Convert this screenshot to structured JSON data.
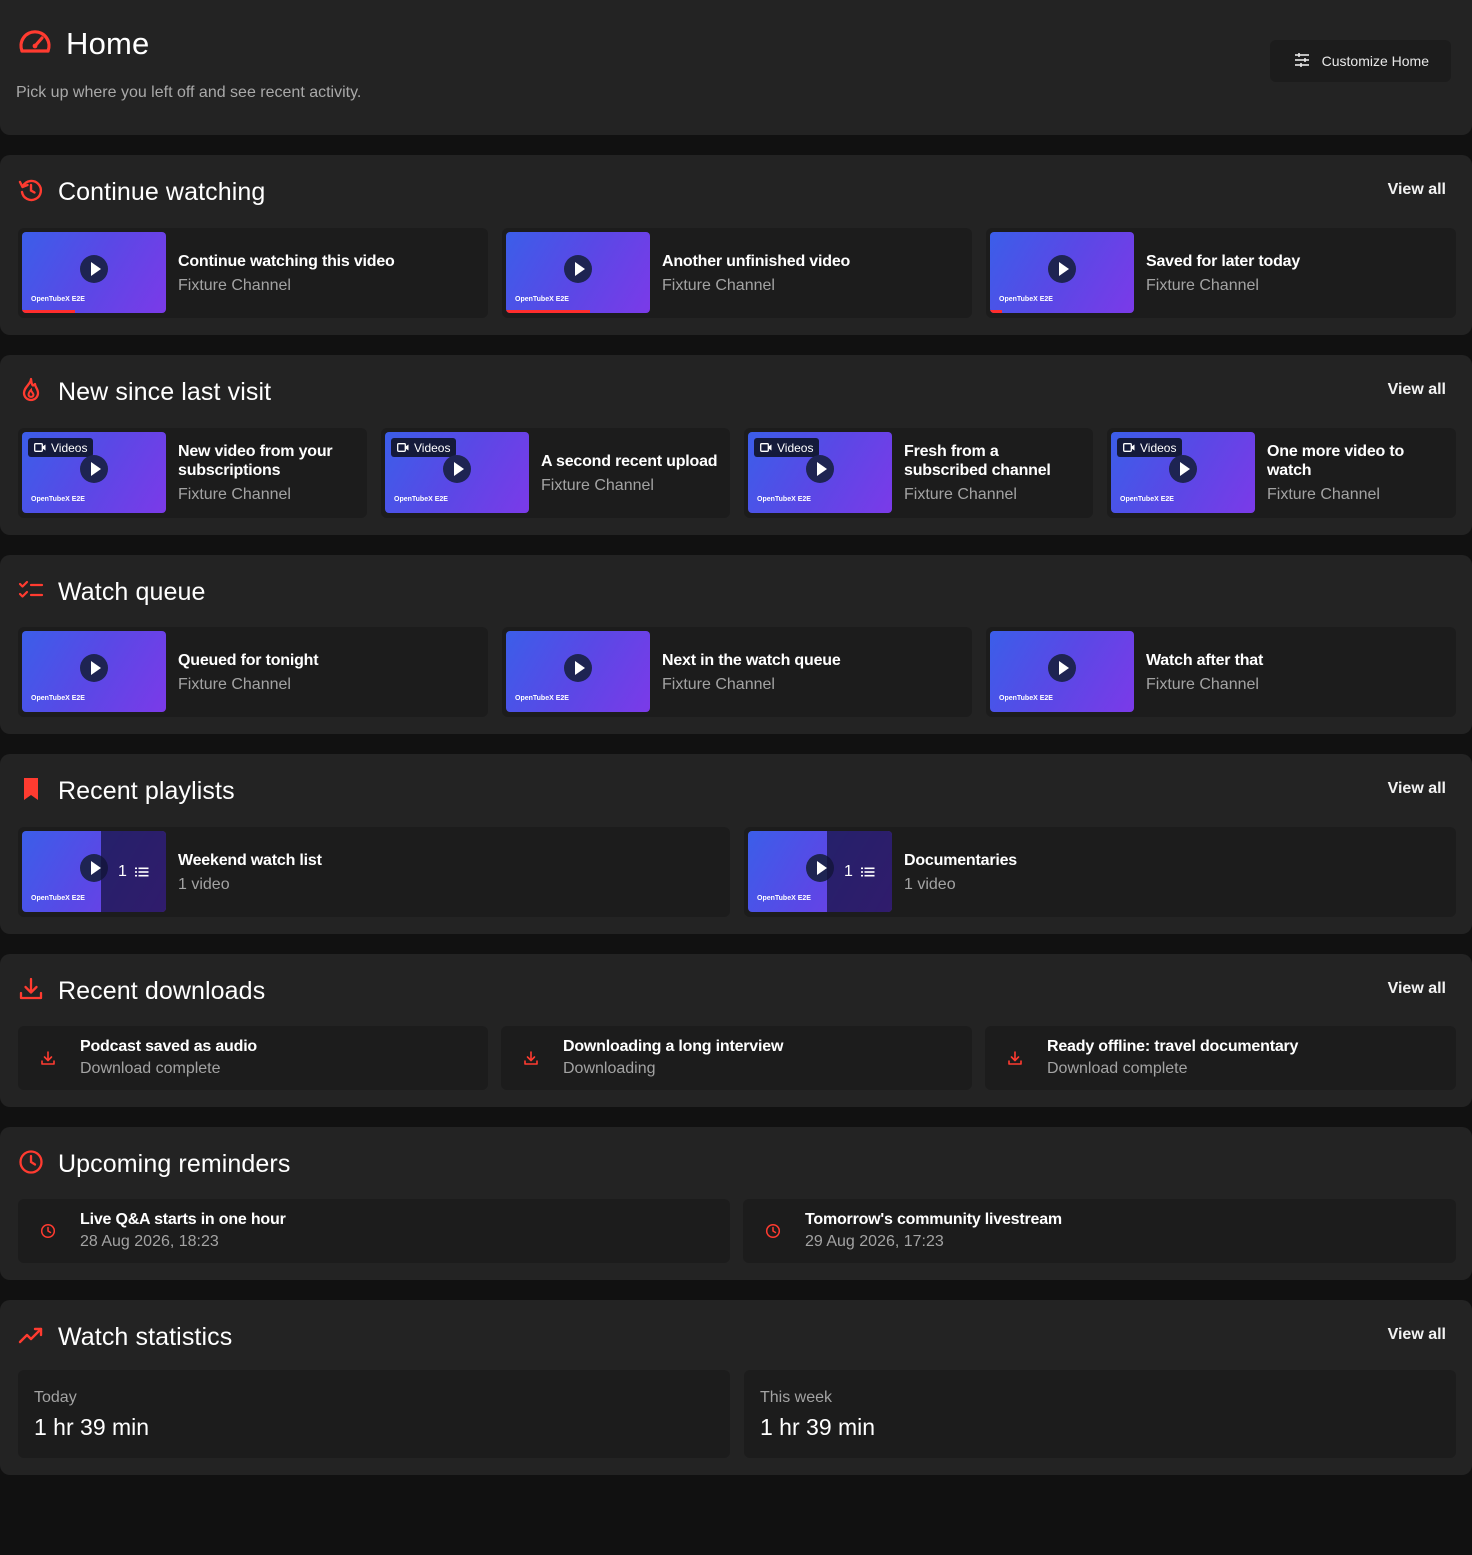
{
  "header": {
    "title": "Home",
    "subtitle": "Pick up where you left off and see recent activity.",
    "customize_label": "Customize Home"
  },
  "brand_text": "OpenTubeX E2E",
  "accent_color": "#ff3b30",
  "continue": {
    "title": "Continue watching",
    "view_all": "View all",
    "items": [
      {
        "title": "Continue watching this video",
        "channel": "Fixture Channel",
        "progress": 0.37
      },
      {
        "title": "Another unfinished video",
        "channel": "Fixture Channel",
        "progress": 0.58
      },
      {
        "title": "Saved for later today",
        "channel": "Fixture Channel",
        "progress": 0.08
      }
    ]
  },
  "new_since": {
    "title": "New since last visit",
    "view_all": "View all",
    "tag": "Videos",
    "items": [
      {
        "title": "New video from your subscriptions",
        "channel": "Fixture Channel"
      },
      {
        "title": "A second recent upload",
        "channel": "Fixture Channel"
      },
      {
        "title": "Fresh from a subscribed channel",
        "channel": "Fixture Channel"
      },
      {
        "title": "One more video to watch",
        "channel": "Fixture Channel"
      }
    ]
  },
  "queue": {
    "title": "Watch queue",
    "items": [
      {
        "title": "Queued for tonight",
        "channel": "Fixture Channel"
      },
      {
        "title": "Next in the watch queue",
        "channel": "Fixture Channel"
      },
      {
        "title": "Watch after that",
        "channel": "Fixture Channel"
      }
    ]
  },
  "playlists": {
    "title": "Recent playlists",
    "view_all": "View all",
    "items": [
      {
        "title": "Weekend watch list",
        "count_text": "1 video",
        "count": "1"
      },
      {
        "title": "Documentaries",
        "count_text": "1 video",
        "count": "1"
      }
    ]
  },
  "downloads": {
    "title": "Recent downloads",
    "view_all": "View all",
    "items": [
      {
        "title": "Podcast saved as audio",
        "status": "Download complete"
      },
      {
        "title": "Downloading a long interview",
        "status": "Downloading"
      },
      {
        "title": "Ready offline: travel documentary",
        "status": "Download complete"
      }
    ]
  },
  "reminders": {
    "title": "Upcoming reminders",
    "items": [
      {
        "title": "Live Q&A starts in one hour",
        "time": "28 Aug 2026, 18:23"
      },
      {
        "title": "Tomorrow's community livestream",
        "time": "29 Aug 2026, 17:23"
      }
    ]
  },
  "stats": {
    "title": "Watch statistics",
    "view_all": "View all",
    "items": [
      {
        "label": "Today",
        "value": "1 hr 39 min"
      },
      {
        "label": "This week",
        "value": "1 hr 39 min"
      }
    ]
  }
}
